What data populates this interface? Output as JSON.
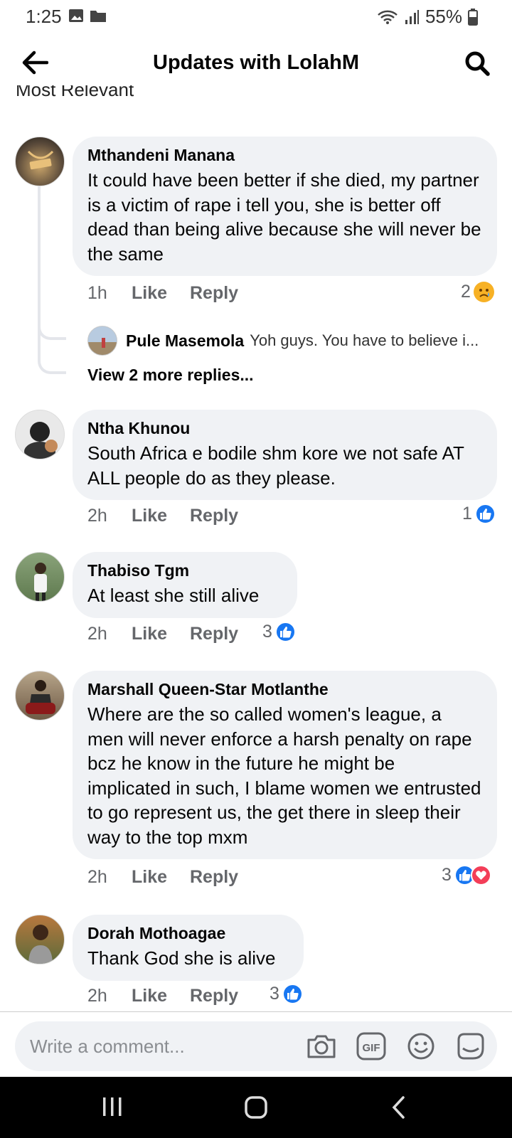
{
  "status_bar": {
    "time": "1:25",
    "battery": "55%"
  },
  "header": {
    "title": "Updates with LolahM"
  },
  "sort_label": "Most Relevant",
  "comments": [
    {
      "name": "Mthandeni Manana",
      "text": "It could have been better if she died, my partner is a victim of rape i tell you, she is better off dead than being alive because she will never be the same",
      "time": "1h",
      "like": "Like",
      "reply": "Reply",
      "reaction_count": "2",
      "reactions": [
        "sad"
      ]
    },
    {
      "name": "Ntha Khunou",
      "text": "South Africa e bodile shm kore we not safe AT ALL people do as they please.",
      "time": "2h",
      "like": "Like",
      "reply": "Reply",
      "reaction_count": "1",
      "reactions": [
        "like"
      ]
    },
    {
      "name": "Thabiso Tgm",
      "text": "At least she still alive",
      "time": "2h",
      "like": "Like",
      "reply": "Reply",
      "reaction_count": "3",
      "reactions": [
        "like"
      ]
    },
    {
      "name": "Marshall Queen-Star Motlanthe",
      "text": "Where are the so called women's league, a men will never enforce a harsh penalty on rape bcz he know in the future he might be implicated in such, I blame women we entrusted to go represent us, the get there in sleep their way to the top mxm",
      "time": "2h",
      "like": "Like",
      "reply": "Reply",
      "reaction_count": "3",
      "reactions": [
        "like",
        "love"
      ]
    },
    {
      "name": "Dorah Mothoagae",
      "text": "Thank God she is alive",
      "time": "2h",
      "like": "Like",
      "reply": "Reply",
      "reaction_count": "3",
      "reactions": [
        "like"
      ]
    }
  ],
  "reply_preview": {
    "name": "Pule Masemola",
    "text": "Yoh guys. You have to believe i..."
  },
  "view_more": "View 2 more replies...",
  "composer": {
    "placeholder": "Write a comment...",
    "icons": [
      "camera-icon",
      "gif-icon",
      "emoji-icon",
      "sticker-icon"
    ]
  },
  "colors": {
    "accent": "#1877f2",
    "bubble": "#f0f2f5",
    "love": "#f33e58",
    "sad": "#f7b125"
  }
}
